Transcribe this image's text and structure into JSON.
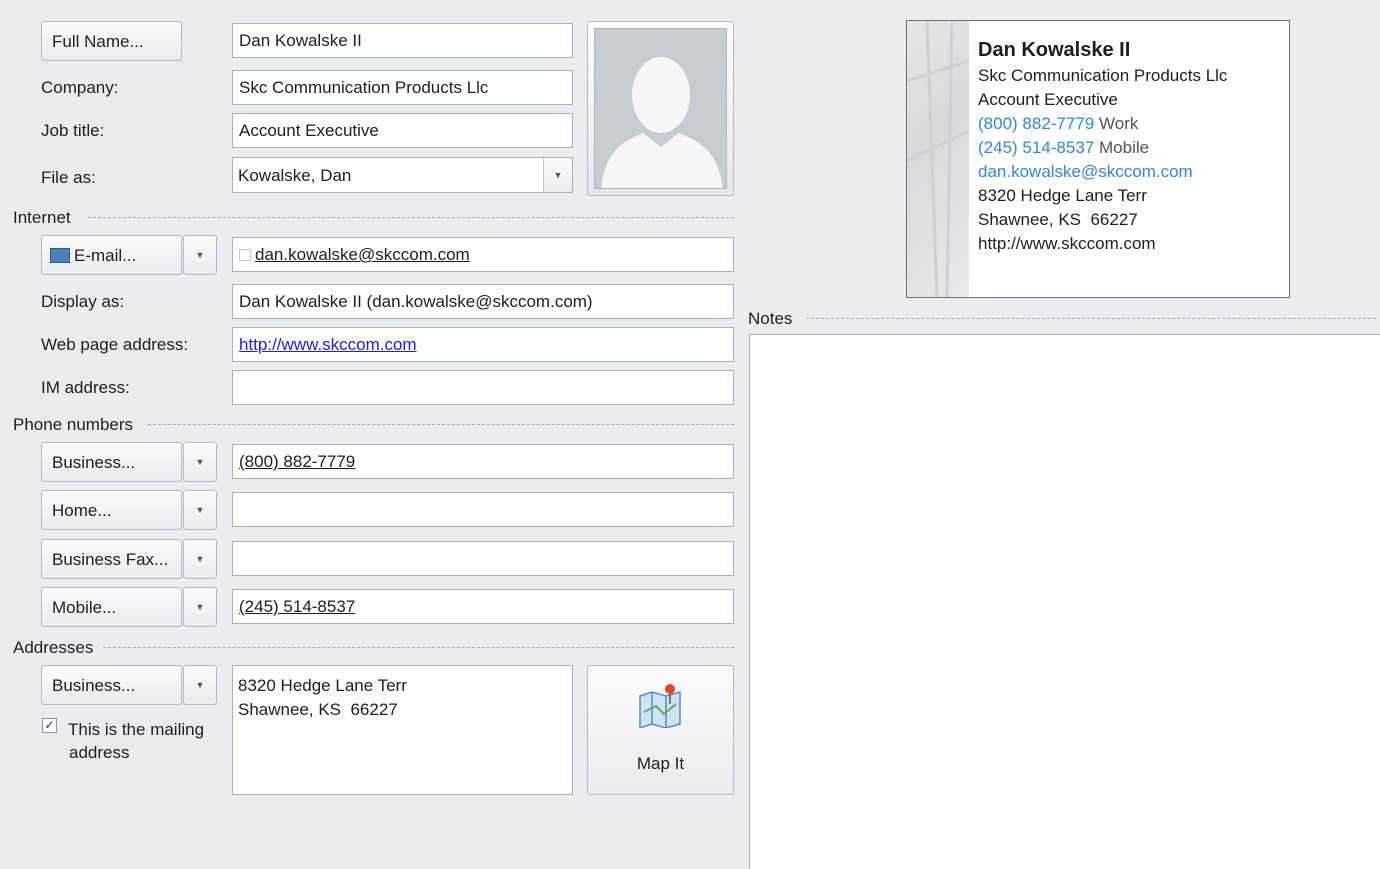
{
  "general": {
    "full_name_button": "Full Name...",
    "full_name": "Dan Kowalske II",
    "company_label": "Company:",
    "company": "Skc Communication Products Llc",
    "job_title_label": "Job title:",
    "job_title": "Account Executive",
    "file_as_label": "File as:",
    "file_as": "Kowalske, Dan"
  },
  "internet": {
    "section_label": "Internet",
    "email_button": "E-mail...",
    "email": "dan.kowalske@skccom.com",
    "display_as_label": "Display as:",
    "display_as": "Dan Kowalske II (dan.kowalske@skccom.com)",
    "web_label": "Web page address:",
    "web": "http://www.skccom.com",
    "im_label": "IM address:",
    "im": ""
  },
  "phones": {
    "section_label": "Phone numbers",
    "business_button": "Business...",
    "business": "(800) 882-7779",
    "home_button": "Home...",
    "home": "",
    "fax_button": "Business Fax...",
    "fax": "",
    "mobile_button": "Mobile...",
    "mobile": "(245) 514-8537"
  },
  "addresses": {
    "section_label": "Addresses",
    "type_button": "Business...",
    "line1": "8320 Hedge Lane Terr",
    "line2": "Shawnee, KS  66227",
    "mailing_checkbox_line1": "This is the mailing",
    "mailing_checkbox_line2": "address",
    "mailing_checked": true,
    "map_button": "Map It"
  },
  "notes": {
    "section_label": "Notes",
    "content": ""
  },
  "business_card": {
    "name": "Dan Kowalske II",
    "company": "Skc Communication Products Llc",
    "title": "Account Executive",
    "phone1": "(800) 882-7779",
    "phone1_type": "Work",
    "phone2": "(245) 514-8537",
    "phone2_type": "Mobile",
    "email": "dan.kowalske@skccom.com",
    "street": "8320 Hedge Lane Terr",
    "city": "Shawnee, KS  66227",
    "web": "http://www.skccom.com"
  },
  "colors": {
    "background": "#e9edf2",
    "link_blue": "#1f1fd6",
    "card_accent": "#3a86c8"
  },
  "icons": [
    "address-book-icon",
    "dropdown-arrow-icon",
    "contact-photo-placeholder",
    "map-icon",
    "checkbox-icon"
  ]
}
